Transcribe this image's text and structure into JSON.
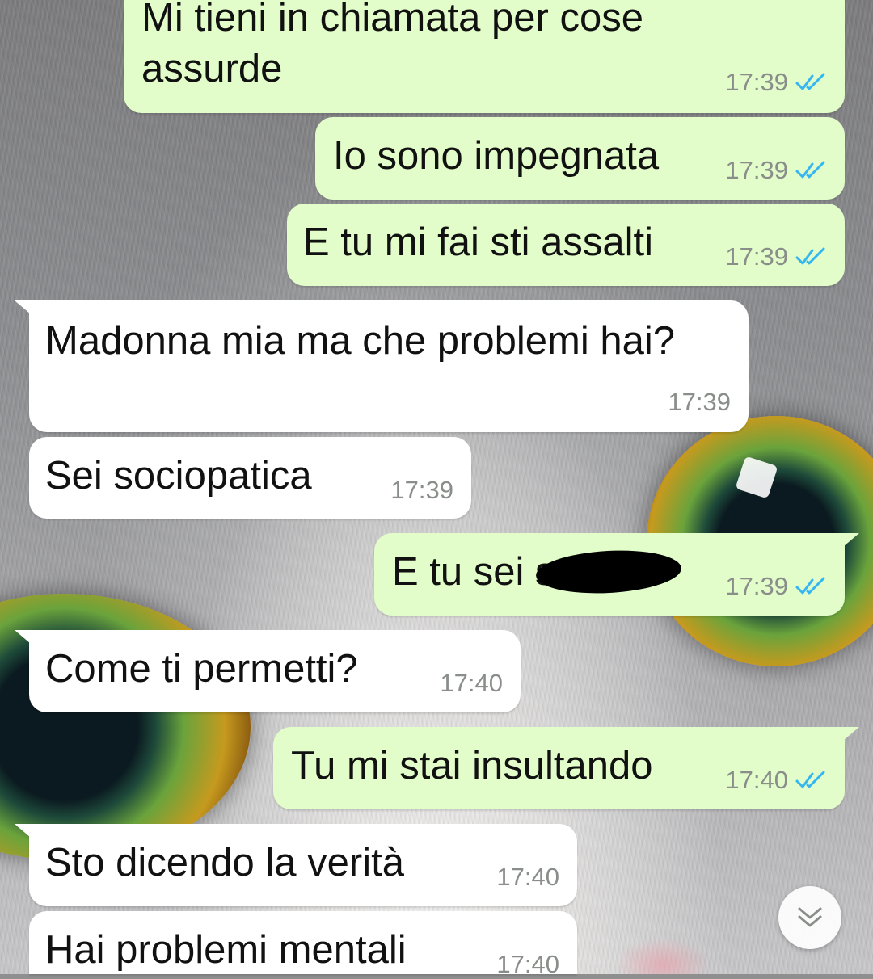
{
  "messages": [
    {
      "text": "Mi tieni in chiamata per cose assurde",
      "line1": "Mi tieni in chiamata per cose",
      "line2": "assurde",
      "time": "17:39",
      "direction": "outgoing",
      "status": "read"
    },
    {
      "text": "Io sono impegnata",
      "time": "17:39",
      "direction": "outgoing",
      "status": "read"
    },
    {
      "text": "E tu mi fai sti assalti",
      "time": "17:39",
      "direction": "outgoing",
      "status": "read"
    },
    {
      "text": "Madonna mia ma che problemi hai?",
      "time": "17:39",
      "direction": "incoming"
    },
    {
      "text": "Sei sociopatica",
      "time": "17:39",
      "direction": "incoming"
    },
    {
      "text": "E tu sei st",
      "time": "17:39",
      "direction": "outgoing",
      "status": "read",
      "redacted": true
    },
    {
      "text": "Come ti permetti?",
      "time": "17:40",
      "direction": "incoming"
    },
    {
      "text": "Tu mi stai insultando",
      "time": "17:40",
      "direction": "outgoing",
      "status": "read"
    },
    {
      "text": "Sto dicendo la verità",
      "time": "17:40",
      "direction": "incoming"
    },
    {
      "text": "Hai problemi mentali",
      "time": "17:40",
      "direction": "incoming"
    }
  ],
  "colors": {
    "outgoing_bubble": "#e2fdc9",
    "incoming_bubble": "#ffffff",
    "read_ticks": "#34b7f1",
    "timestamp": "#8a8e8a"
  },
  "icons": {
    "read_receipt": "double-check-icon",
    "scroll_down": "chevron-double-down-icon"
  }
}
